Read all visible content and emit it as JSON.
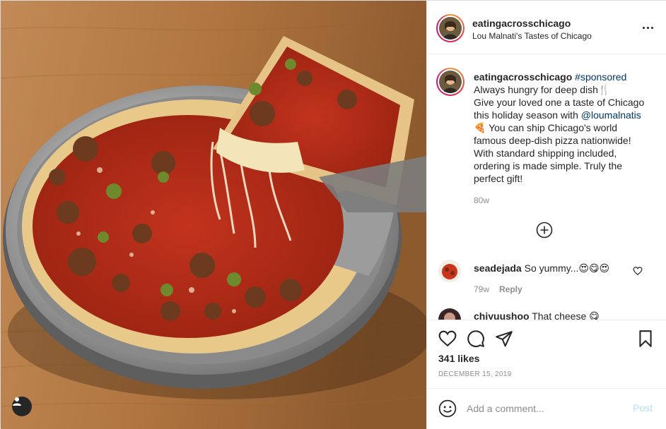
{
  "post": {
    "author": "eatingacrosschicago",
    "location": "Lou Malnati's Tastes of Chicago"
  },
  "caption": {
    "user": "eatingacrosschicago",
    "hashtag": "#sponsored",
    "line1": "Always hungry for deep dish🍴",
    "line2": "Give your loved one a taste of Chicago this holiday season with ",
    "mention": "@loumalnatis",
    "line3": " 🍕 You can ship Chicago's world famous deep-dish pizza nationwide! With standard shipping included, ordering is made simple. Truly the perfect gift!",
    "time": "80w"
  },
  "comments": [
    {
      "user": "seadejada",
      "text": "So yummy...😍😋😍",
      "time": "79w",
      "reply": "Reply"
    },
    {
      "user": "chiyuushoo",
      "text": "That cheese 😋"
    }
  ],
  "icons": {
    "more": "more-options-icon",
    "load_more": "plus-circle-icon",
    "like": "heart-icon",
    "comment": "comment-icon",
    "share": "paper-plane-icon",
    "save": "bookmark-icon",
    "emoji": "smiley-icon",
    "tag": "user-tag-icon"
  },
  "likes": "341 likes",
  "date": "DECEMBER 15, 2019",
  "add_comment": {
    "placeholder": "Add a comment...",
    "post_label": "Post"
  },
  "colors": {
    "link": "#00376b",
    "muted": "#8e8e8e",
    "post_disabled": "#b2dffc",
    "text": "#262626"
  }
}
